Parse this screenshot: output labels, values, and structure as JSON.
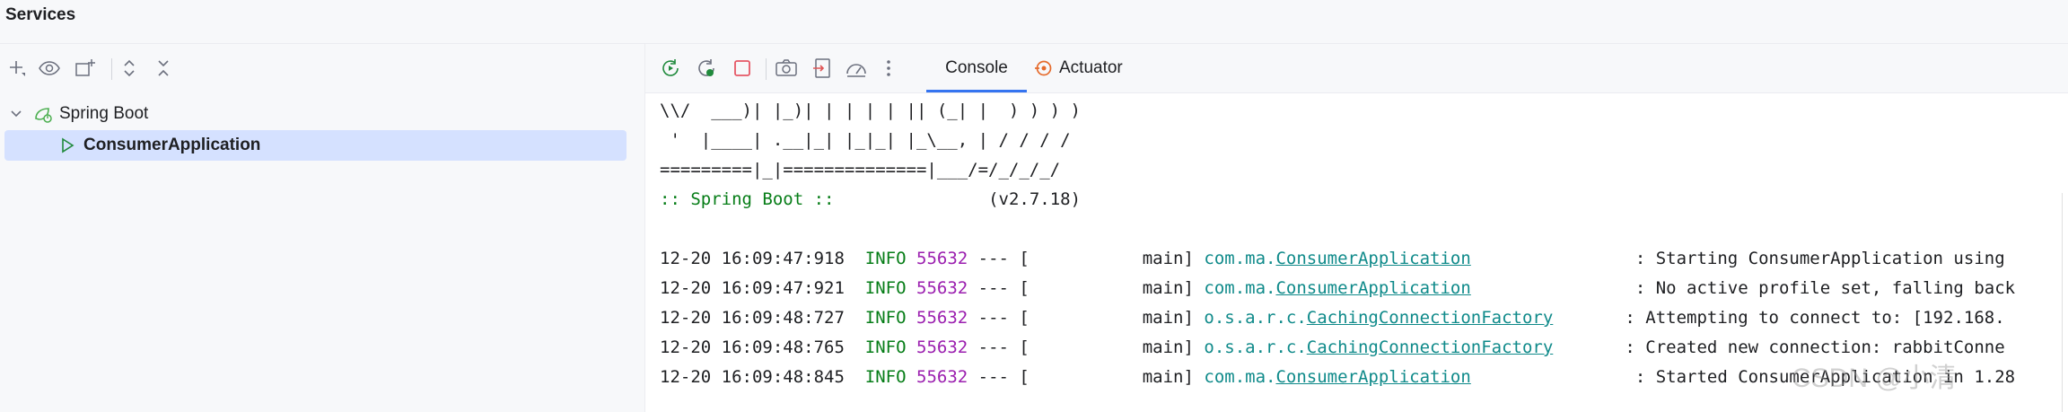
{
  "window": {
    "title": "Services"
  },
  "tree": {
    "group_label": "Spring Boot",
    "app_label": "ConsumerApplication"
  },
  "tabs": [
    {
      "label": "Console"
    },
    {
      "label": "Actuator"
    }
  ],
  "banner": {
    "line1": "\\\\/  ___)| |_)| | | | | || (_| |  ) ) ) )",
    "line2": " '  |____| .__|_| |_|_| |_\\__, | / / / /",
    "line3": "=========|_|==============|___/=/_/_/_/",
    "spring_label": ":: Spring Boot ::",
    "version": "(v2.7.18)"
  },
  "logs": [
    {
      "ts": "12-20 16:09:47:918",
      "level": "INFO",
      "pid": "55632",
      "sep": "--- [",
      "thread": "main]",
      "pkg": "com.ma.",
      "cls": "ConsumerApplication",
      "msg": ": Starting ConsumerApplication using"
    },
    {
      "ts": "12-20 16:09:47:921",
      "level": "INFO",
      "pid": "55632",
      "sep": "--- [",
      "thread": "main]",
      "pkg": "com.ma.",
      "cls": "ConsumerApplication",
      "msg": ": No active profile set, falling back"
    },
    {
      "ts": "12-20 16:09:48:727",
      "level": "INFO",
      "pid": "55632",
      "sep": "--- [",
      "thread": "main]",
      "pkg": "o.s.a.r.c.",
      "cls": "CachingConnectionFactory",
      "msg": ": Attempting to connect to: [192.168."
    },
    {
      "ts": "12-20 16:09:48:765",
      "level": "INFO",
      "pid": "55632",
      "sep": "--- [",
      "thread": "main]",
      "pkg": "o.s.a.r.c.",
      "cls": "CachingConnectionFactory",
      "msg": ": Created new connection: rabbitConne"
    },
    {
      "ts": "12-20 16:09:48:845",
      "level": "INFO",
      "pid": "55632",
      "sep": "--- [",
      "thread": "main]",
      "pkg": "com.ma.",
      "cls": "ConsumerApplication",
      "msg": ": Started ConsumerApplication in 1.28"
    }
  ],
  "watermark": "CSDN @小清",
  "icons": {
    "left_toolbar": [
      "add-icon",
      "eye-icon",
      "new-group-icon",
      "expand-all-icon",
      "collapse-all-icon"
    ],
    "right_toolbar": [
      "rerun-icon",
      "restart-debug-icon",
      "stop-icon",
      "screenshot-icon",
      "export-icon",
      "profiler-icon",
      "more-icon"
    ],
    "actuator": "actuator-icon"
  },
  "colors": {
    "accent": "#3574f0",
    "selection": "#d5e1ff",
    "log_level": "#067d17",
    "pid": "#9b1faf",
    "logger": "#0f8a8a",
    "stop": "#e55765"
  }
}
